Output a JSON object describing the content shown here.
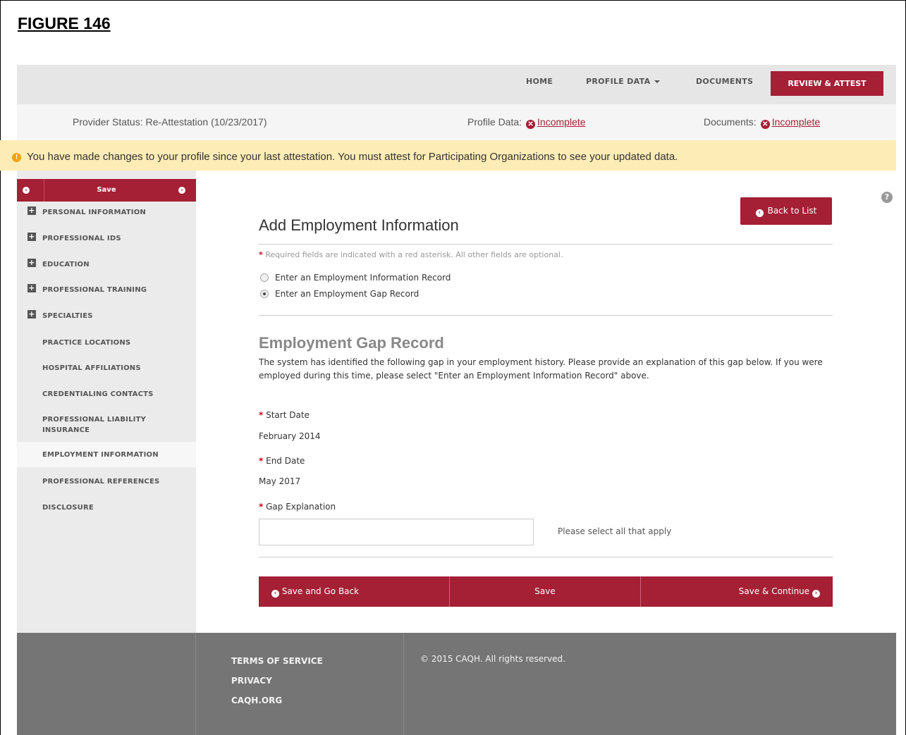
{
  "figure_title": "FIGURE 146",
  "nav": {
    "home": "HOME",
    "profile_data": "PROFILE DATA",
    "documents": "DOCUMENTS",
    "review_attest": "REVIEW & ATTEST"
  },
  "status": {
    "provider_label": "Provider Status:",
    "provider_value": "Re-Attestation (10/23/2017)",
    "profile_label": "Profile Data:",
    "profile_value": "Incomplete",
    "documents_label": "Documents:",
    "documents_value": "Incomplete"
  },
  "warning": {
    "text": "You have made changes to your profile since your last attestation. You must attest for Participating Organizations to see your updated data."
  },
  "sidebar": {
    "save_label": "Save",
    "items": [
      {
        "label": "PERSONAL INFORMATION",
        "expandable": true
      },
      {
        "label": "PROFESSIONAL IDS",
        "expandable": true
      },
      {
        "label": "EDUCATION",
        "expandable": true
      },
      {
        "label": "PROFESSIONAL TRAINING",
        "expandable": true
      },
      {
        "label": "SPECIALTIES",
        "expandable": true
      },
      {
        "label": "PRACTICE LOCATIONS",
        "expandable": false
      },
      {
        "label": "HOSPITAL AFFILIATIONS",
        "expandable": false
      },
      {
        "label": "CREDENTIALING CONTACTS",
        "expandable": false
      },
      {
        "label": "PROFESSIONAL LIABILITY INSURANCE",
        "expandable": false
      },
      {
        "label": "EMPLOYMENT INFORMATION",
        "expandable": false,
        "active": true
      },
      {
        "label": "PROFESSIONAL REFERENCES",
        "expandable": false
      },
      {
        "label": "DISCLOSURE",
        "expandable": false
      }
    ]
  },
  "main": {
    "title": "Add Employment Information",
    "back_button": "Back to List",
    "required_note": "Required fields are indicated with a red asterisk. All other fields are optional.",
    "radio_options": [
      {
        "label": "Enter an Employment Information Record",
        "selected": false
      },
      {
        "label": "Enter an Employment Gap Record",
        "selected": true
      }
    ],
    "gap_title": "Employment Gap Record",
    "gap_description": "The system has identified the following gap in your employment history. Please provide an explanation of this gap below. If you were employed during this time, please select \"Enter an Employment Information Record\" above.",
    "start_date_label": "Start Date",
    "start_date_value": "February 2014",
    "end_date_label": "End Date",
    "end_date_value": "May 2017",
    "gap_explanation_label": "Gap Explanation",
    "gap_explanation_value": "",
    "gap_hint": "Please select all that apply",
    "buttons": {
      "save_back": "Save and Go Back",
      "save": "Save",
      "save_continue": "Save & Continue"
    }
  },
  "footer": {
    "links": [
      "TERMS OF SERVICE",
      "PRIVACY",
      "CAQH.ORG"
    ],
    "copyright": "© 2015 CAQH. All rights reserved."
  },
  "colors": {
    "brand": "#a51f35",
    "warning_bg": "#fdecb5",
    "footer_bg": "#757575"
  }
}
